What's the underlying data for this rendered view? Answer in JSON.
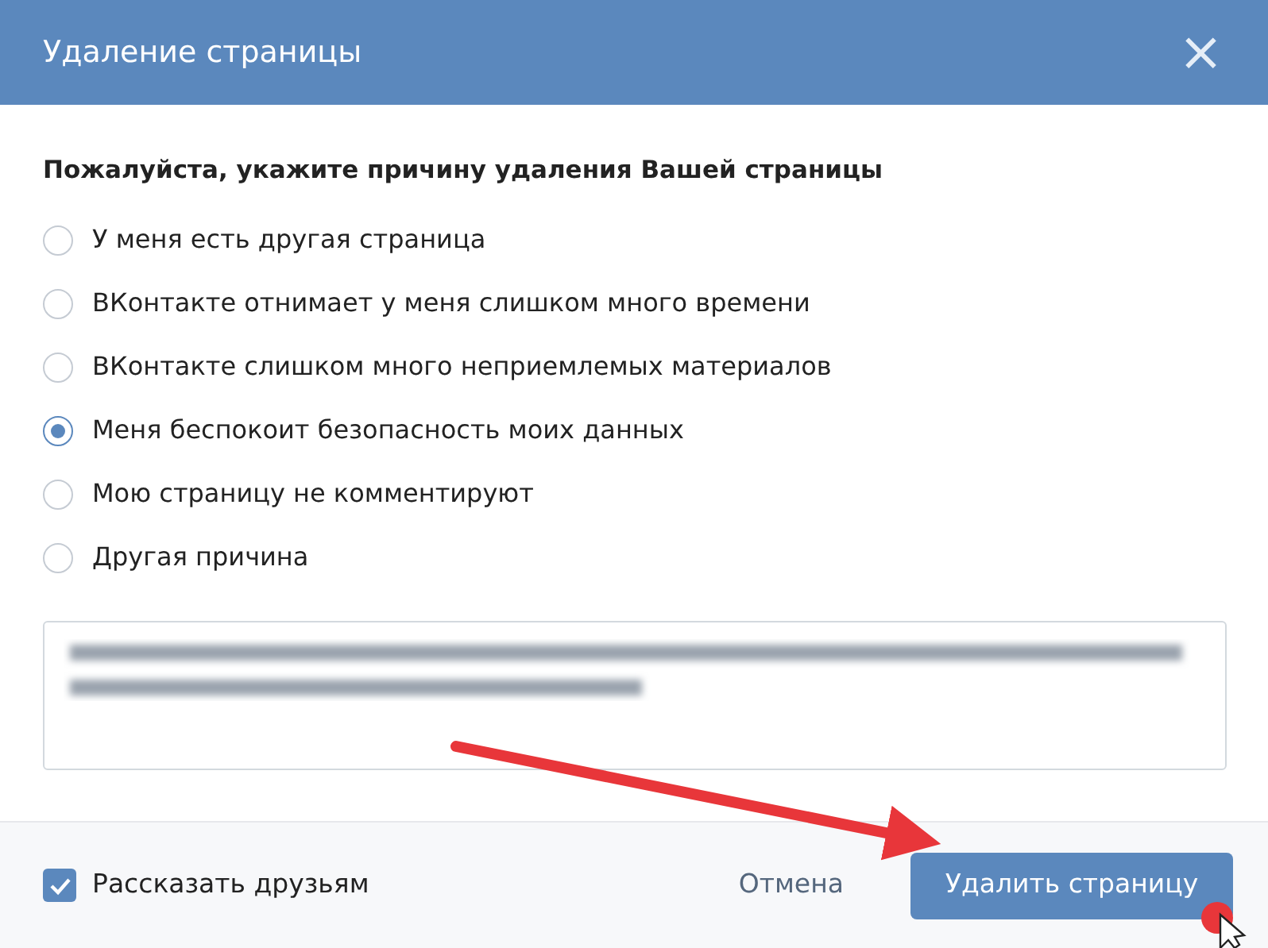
{
  "window": {
    "title": "Удаление страницы",
    "close": "×"
  },
  "prompt": "Пожалуйста, укажите причину удаления Вашей страницы",
  "reasons": [
    {
      "label": "У меня есть другая страница",
      "selected": false
    },
    {
      "label": "ВКонтакте отнимает у меня слишком много времени",
      "selected": false
    },
    {
      "label": "ВКонтакте слишком много неприемлемых материалов",
      "selected": false
    },
    {
      "label": "Меня беспокоит безопасность моих данных",
      "selected": true
    },
    {
      "label": "Мою страницу не комментируют",
      "selected": false
    },
    {
      "label": "Другая причина",
      "selected": false
    }
  ],
  "comment": {
    "blurred": true
  },
  "footer": {
    "tell_friends": {
      "label": "Рассказать друзьям",
      "checked": true
    },
    "cancel": "Отмена",
    "confirm": "Удалить страницу"
  }
}
